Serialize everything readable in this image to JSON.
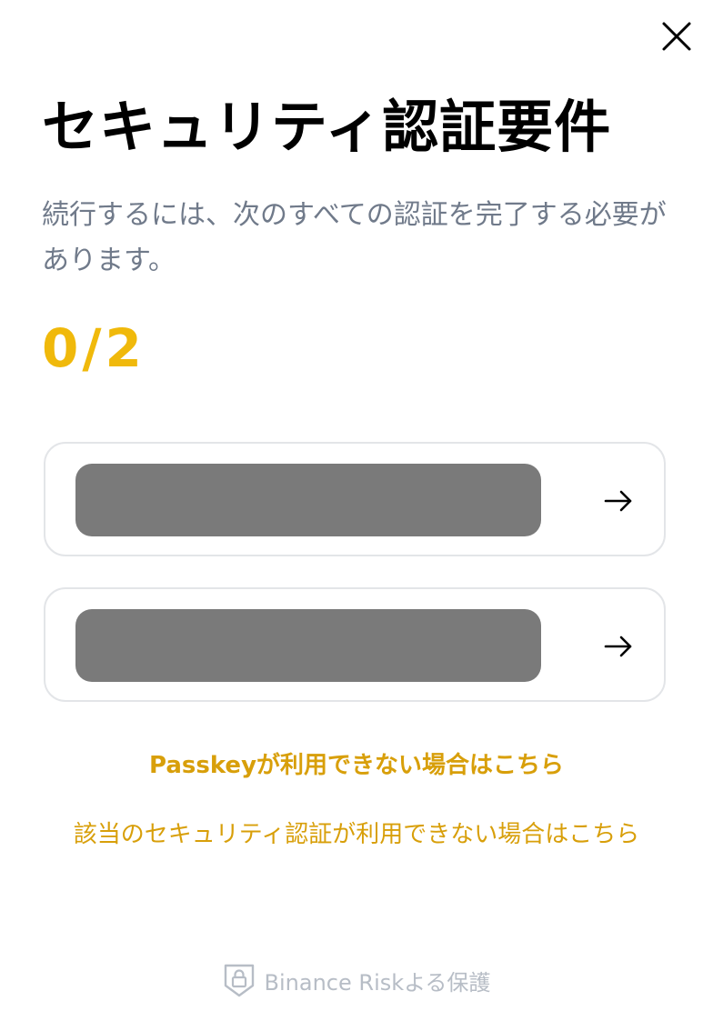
{
  "header": {
    "close_icon": "close-icon"
  },
  "title": "セキュリティ認証要件",
  "subtitle": "続行するには、次のすべての認証を完了する必要があります。",
  "progress": {
    "text": "0/2",
    "completed": 0,
    "total": 2,
    "color": "#f0b90b"
  },
  "methods": [
    {
      "label": "",
      "icon": "arrow-right-icon"
    },
    {
      "label": "",
      "icon": "arrow-right-icon"
    }
  ],
  "links": {
    "passkey_unavailable": "Passkeyが利用できない場合はこちら",
    "security_unavailable": "該当のセキュリティ認証が利用できない場合はこちら",
    "color": "#d89f0a"
  },
  "footer": {
    "icon": "shield-lock-icon",
    "text": "Binance Riskよる保護"
  }
}
